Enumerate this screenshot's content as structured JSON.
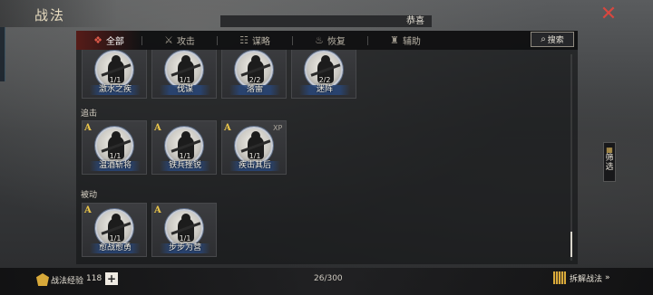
{
  "header": {
    "title": "战法",
    "announcement": "恭喜",
    "close_icon": "close-icon"
  },
  "tabs": [
    {
      "label": "全部",
      "icon": "all-icon",
      "active": true
    },
    {
      "label": "攻击",
      "icon": "swords-icon",
      "active": false
    },
    {
      "label": "谋略",
      "icon": "scroll-icon",
      "active": false
    },
    {
      "label": "恢复",
      "icon": "pot-icon",
      "active": false
    },
    {
      "label": "辅助",
      "icon": "bag-icon",
      "active": false
    }
  ],
  "search": {
    "label": "搜索",
    "icon": "search-icon"
  },
  "sections": [
    {
      "label": "",
      "cards": [
        {
          "name": "激水之疾",
          "count": "1/1",
          "grade": "",
          "xp": ""
        },
        {
          "name": "伐谋",
          "count": "1/1",
          "grade": "",
          "xp": ""
        },
        {
          "name": "落雷",
          "count": "2/2",
          "grade": "",
          "xp": ""
        },
        {
          "name": "迷阵",
          "count": "2/2",
          "grade": "",
          "xp": ""
        }
      ]
    },
    {
      "label": "追击",
      "cards": [
        {
          "name": "温酒斩将",
          "count": "1/1",
          "grade": "A",
          "xp": ""
        },
        {
          "name": "铁兵挫锐",
          "count": "1/1",
          "grade": "A",
          "xp": ""
        },
        {
          "name": "疾击其后",
          "count": "1/1",
          "grade": "A",
          "xp": "XP"
        }
      ]
    },
    {
      "label": "被动",
      "cards": [
        {
          "name": "愈战愈勇",
          "count": "1/1",
          "grade": "A",
          "xp": ""
        },
        {
          "name": "步步为营",
          "count": "1/1",
          "grade": "A",
          "xp": ""
        }
      ]
    }
  ],
  "filter": {
    "label": "筛选",
    "icon": "filter-grid-icon"
  },
  "footer": {
    "exp_label": "战法经验",
    "exp_value": "118",
    "plus_label": "+",
    "capacity": "26/300",
    "dismantle_label": "拆解战法",
    "dismantle_arrow": "»"
  },
  "colors": {
    "accent_red": "#d8473f",
    "gold": "#d8a93a",
    "banner_blue": "#284678"
  }
}
